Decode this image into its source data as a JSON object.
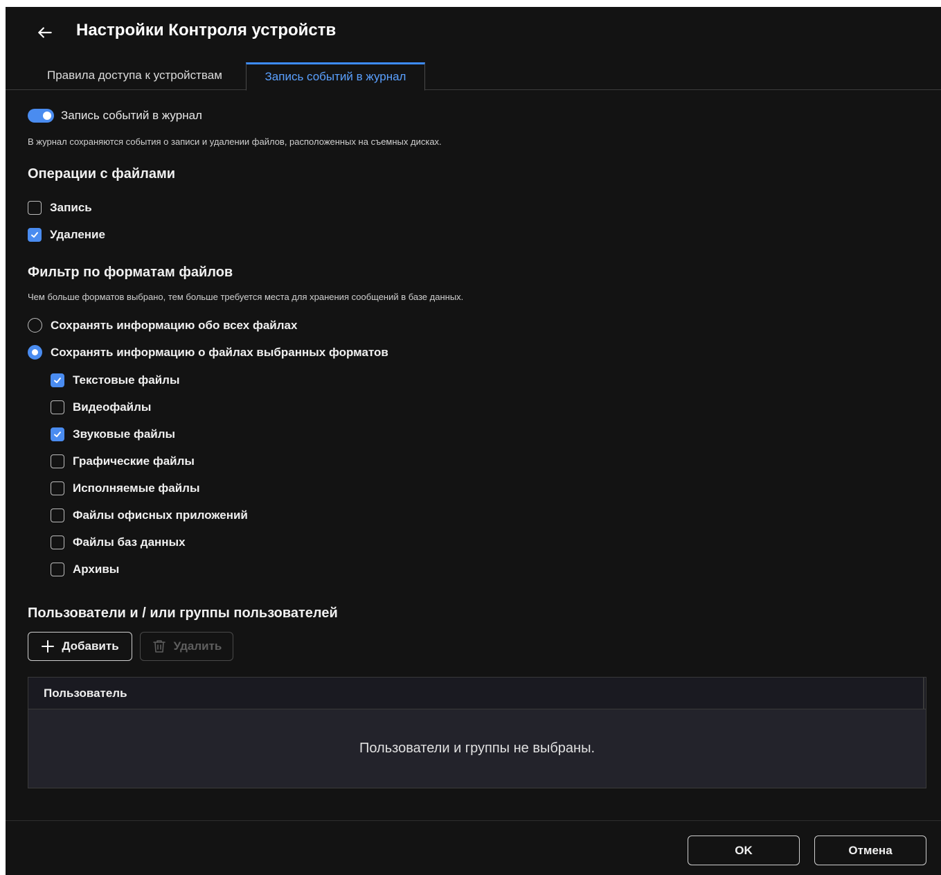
{
  "header": {
    "title": "Настройки Контроля устройств"
  },
  "tabs": [
    {
      "label": "Правила доступа к устройствам"
    },
    {
      "label": "Запись событий в журнал"
    }
  ],
  "logging": {
    "toggle_label": "Запись событий в журнал",
    "toggle_on": true,
    "description": "В журнал сохраняются события о записи и удалении файлов, расположенных на съемных дисках."
  },
  "file_ops": {
    "title": "Операции с файлами",
    "items": [
      {
        "label": "Запись",
        "checked": false
      },
      {
        "label": "Удаление",
        "checked": true
      }
    ]
  },
  "format_filter": {
    "title": "Фильтр по форматам файлов",
    "description": "Чем больше форматов выбрано, тем больше требуется места для хранения сообщений в базе данных.",
    "radios": [
      {
        "label": "Сохранять информацию обо всех файлах",
        "selected": false
      },
      {
        "label": "Сохранять информацию о файлах выбранных форматов",
        "selected": true
      }
    ],
    "formats": [
      {
        "label": "Текстовые файлы",
        "checked": true
      },
      {
        "label": "Видеофайлы",
        "checked": false
      },
      {
        "label": "Звуковые файлы",
        "checked": true
      },
      {
        "label": "Графические файлы",
        "checked": false
      },
      {
        "label": "Исполняемые файлы",
        "checked": false
      },
      {
        "label": "Файлы офисных приложений",
        "checked": false
      },
      {
        "label": "Файлы баз данных",
        "checked": false
      },
      {
        "label": "Архивы",
        "checked": false
      }
    ]
  },
  "users": {
    "title": "Пользователи и / или группы пользователей",
    "add_label": "Добавить",
    "delete_label": "Удалить",
    "column_header": "Пользователь",
    "empty_text": "Пользователи и группы не выбраны."
  },
  "footer": {
    "ok_label": "OK",
    "cancel_label": "Отмена"
  },
  "colors": {
    "accent": "#4a8cf0",
    "background": "#131313",
    "table_bg": "#23232b"
  }
}
